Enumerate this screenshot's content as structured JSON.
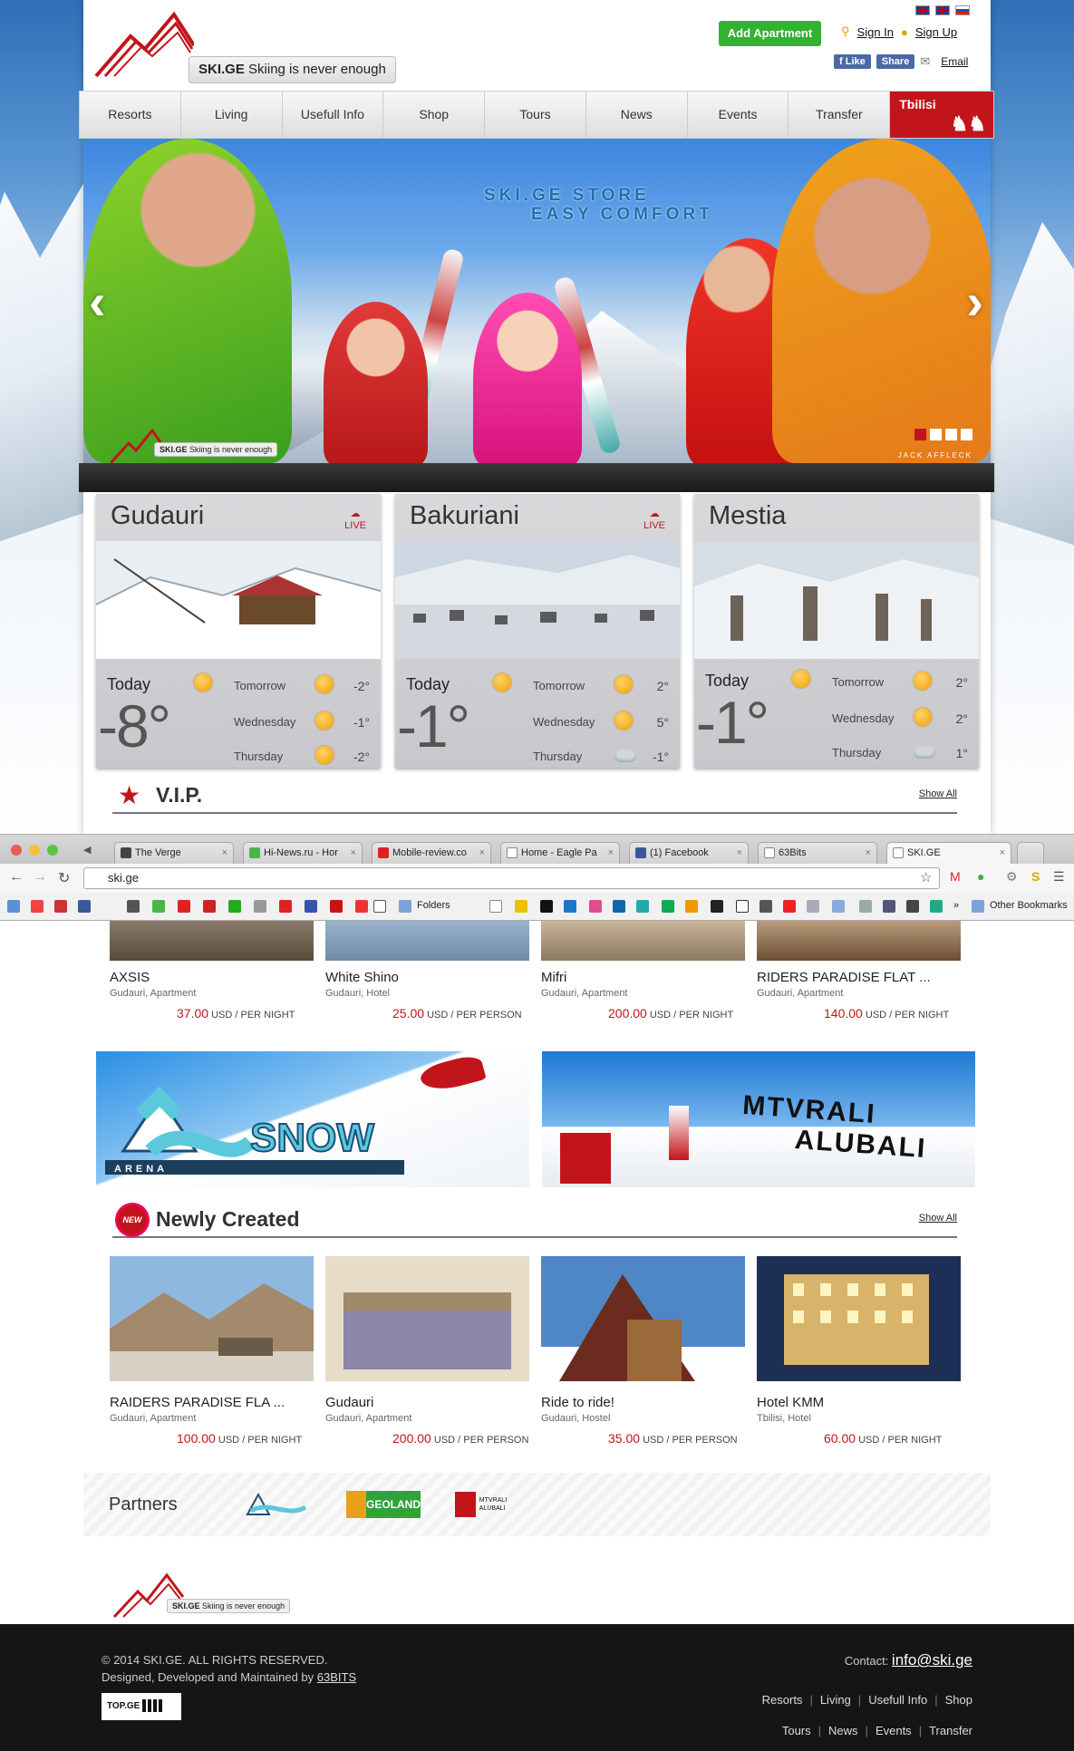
{
  "header": {
    "logo_brand": "SKI.GE",
    "logo_tagline": "Skiing is never enough",
    "add_apartment": "Add Apartment",
    "sign_in": "Sign In",
    "sign_up": "Sign Up",
    "fb_like": "Like",
    "fb_share": "Share",
    "email": "Email"
  },
  "nav": {
    "items": [
      "Resorts",
      "Living",
      "Usefull Info",
      "Shop",
      "Tours",
      "News",
      "Events",
      "Transfer"
    ],
    "city": "Tbilisi"
  },
  "slider": {
    "title_line1": "SKI.GE STORE",
    "title_line2": "EASY COMFORT",
    "credit": "JACK AFFLECK",
    "active_slide": 1,
    "slide_count": 4
  },
  "weather": [
    {
      "resort": "Gudauri",
      "live": "LIVE",
      "today_label": "Today",
      "today_temp": "-8°",
      "forecast": [
        {
          "day": "Tomorrow",
          "temp": "-2°",
          "icon": "sun-icon"
        },
        {
          "day": "Wednesday",
          "temp": "-1°",
          "icon": "sun-icon"
        },
        {
          "day": "Thursday",
          "temp": "-2°",
          "icon": "partly-sunny-icon"
        }
      ]
    },
    {
      "resort": "Bakuriani",
      "live": "LIVE",
      "today_label": "Today",
      "today_temp": "-1°",
      "forecast": [
        {
          "day": "Tomorrow",
          "temp": "2°",
          "icon": "sun-icon"
        },
        {
          "day": "Wednesday",
          "temp": "5°",
          "icon": "sun-icon"
        },
        {
          "day": "Thursday",
          "temp": "-1°",
          "icon": "cloud-icon"
        }
      ]
    },
    {
      "resort": "Mestia",
      "live": "",
      "today_label": "Today",
      "today_temp": "-1°",
      "forecast": [
        {
          "day": "Tomorrow",
          "temp": "2°",
          "icon": "sun-icon"
        },
        {
          "day": "Wednesday",
          "temp": "2°",
          "icon": "sun-icon"
        },
        {
          "day": "Thursday",
          "temp": "1°",
          "icon": "cloud-icon"
        }
      ]
    }
  ],
  "vip": {
    "title": "V.I.P.",
    "show_all": "Show All",
    "items": [
      {
        "name": "AXSIS",
        "sub": "Gudauri, Apartment",
        "price": "37.00",
        "unit": "USD / PER NIGHT"
      },
      {
        "name": "White Shino",
        "sub": "Gudauri, Hotel",
        "price": "25.00",
        "unit": "USD / PER PERSON"
      },
      {
        "name": "Mifri",
        "sub": "Gudauri, Apartment",
        "price": "200.00",
        "unit": "USD / PER NIGHT"
      },
      {
        "name": "RIDERS PARADISE FLAT ...",
        "sub": "Gudauri, Apartment",
        "price": "140.00",
        "unit": "USD / PER NIGHT"
      }
    ]
  },
  "browser": {
    "tabs": [
      "The Verge",
      "Hi-News.ru - Hor",
      "Mobile-review.co",
      "Home - Eagle Pa",
      "(1) Facebook",
      "63Bits",
      "SKI.GE"
    ],
    "url": "ski.ge",
    "bookmarks_folder": "Folders",
    "other_bookmarks": "Other Bookmarks"
  },
  "banners": {
    "snow_arena": "SNOW",
    "snow_arena_sub": "ARENA",
    "mtvrali_line1": "MTVRALI",
    "mtvrali_line2": "ALUBALI"
  },
  "newly": {
    "title": "Newly Created",
    "badge": "NEW",
    "show_all": "Show All",
    "items": [
      {
        "name": "RAIDERS PARADISE FLA ...",
        "sub": "Gudauri, Apartment",
        "price": "100.00",
        "unit": "USD / PER NIGHT"
      },
      {
        "name": "Gudauri",
        "sub": "Gudauri, Apartment",
        "price": "200.00",
        "unit": "USD / PER PERSON"
      },
      {
        "name": "Ride to ride!",
        "sub": "Gudauri, Hostel",
        "price": "35.00",
        "unit": "USD / PER PERSON"
      },
      {
        "name": "Hotel KMM",
        "sub": "Tbilisi, Hotel",
        "price": "60.00",
        "unit": "USD / PER NIGHT"
      }
    ]
  },
  "partners": {
    "label": "Partners",
    "geoland": "GEOLAND",
    "mtvrali": "MTVRALI ALUBALI"
  },
  "footer": {
    "copyright": "© 2014 SKI.GE. ALL RIGHTS RESERVED.",
    "designed": "Designed, Developed and Maintained by",
    "designer": "63BITS",
    "topge": "TOP.GE",
    "contact_label": "Contact:",
    "contact_email": "info@ski.ge",
    "links_row1": [
      "Resorts",
      "Living",
      "Usefull Info",
      "Shop"
    ],
    "links_row2": [
      "Tours",
      "News",
      "Events",
      "Transfer"
    ]
  },
  "colors": {
    "brand_red": "#c2151b",
    "add_green": "#32b232",
    "footer_bg": "#151515"
  }
}
